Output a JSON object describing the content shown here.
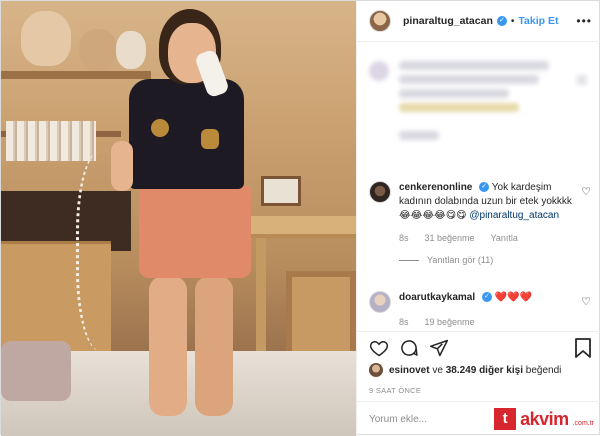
{
  "post": {
    "username": "pinaraltug_atacan",
    "follow_label": "Takip Et",
    "more_label": "•••",
    "verified": true
  },
  "comments": [
    {
      "username": "cenkerenonline",
      "text": "Yok kardeşim kadının dolabında uzun bir etek yokkkk😂😂😂😂😋😋",
      "mention": "@pinaraltug_atacan",
      "age": "8s",
      "likes": "31 beğenme",
      "reply_label": "Yanıtla",
      "view_replies": "Yanıtları gör (11)"
    },
    {
      "username": "doarutkaykamal",
      "text": "❤️❤️❤️",
      "age": "8s",
      "likes": "19 beğenme"
    }
  ],
  "likes": {
    "first_user": "esinovet",
    "text_ve": "ve",
    "count_text": "38.249 diğer kişi",
    "liked": "beğendi"
  },
  "timestamp": "9 SAAT ÖNCE",
  "composer": {
    "placeholder": "Yorum ekle..."
  },
  "watermark": {
    "letter": "t",
    "brand": "akvim",
    "tld": ".com.tr"
  },
  "icons": {
    "heart": "heart-icon",
    "comment": "comment-icon",
    "share": "share-icon",
    "save": "bookmark-icon"
  },
  "colors": {
    "link": "#3897f0",
    "mention": "#00376b",
    "heart": "#ed4956",
    "brand": "#d7262e"
  }
}
